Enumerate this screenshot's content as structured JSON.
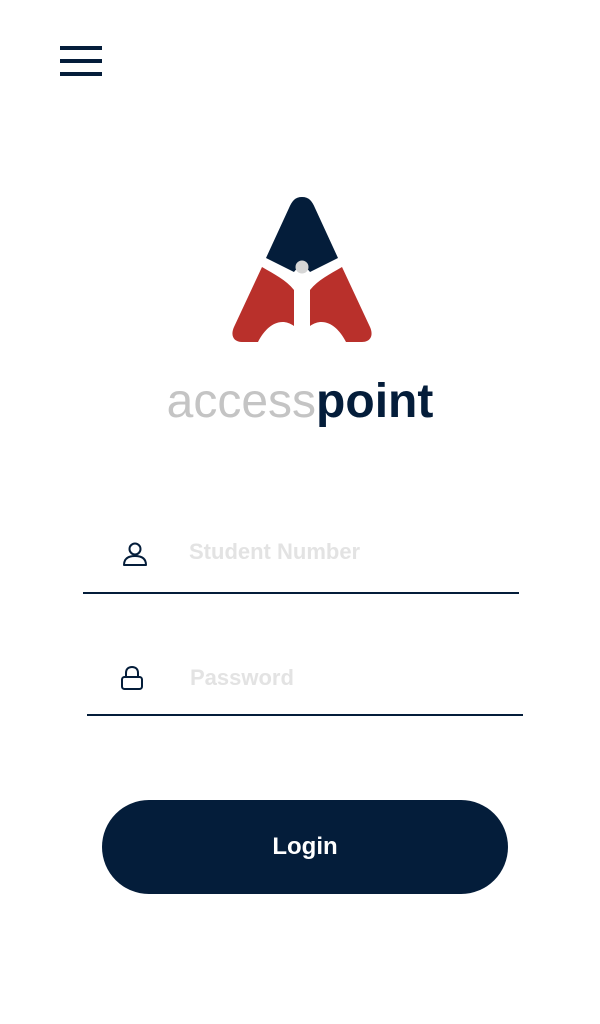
{
  "header": {
    "menu_icon": "hamburger-menu-icon"
  },
  "brand": {
    "name_light": "access",
    "name_bold": "point",
    "logo_icon": "accesspoint-logo",
    "colors": {
      "navy": "#041d3a",
      "red": "#b9302b",
      "gray": "#c4c4c4"
    }
  },
  "form": {
    "student_number": {
      "icon": "user-icon",
      "placeholder": "Student Number",
      "value": ""
    },
    "password": {
      "icon": "lock-icon",
      "placeholder": "Password",
      "value": ""
    },
    "login_label": "Login"
  }
}
